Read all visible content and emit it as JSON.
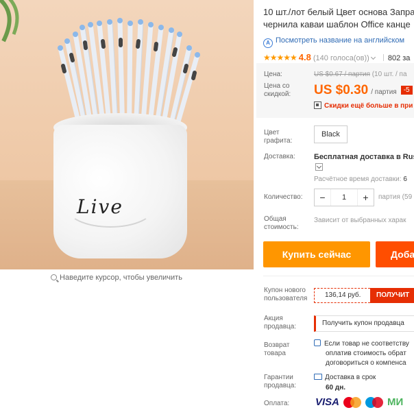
{
  "product": {
    "title_line1": "10 шт./лот белый Цвет основа Запра",
    "title_line2": "чернила каваи шаблон Office канце",
    "translate_label": "Посмотреть название на английском",
    "rating_value": "4.8",
    "votes": "(140 голоса(ов))",
    "orders": "802 за",
    "image_text": "Live",
    "zoom_hint": "Наведите курсор, чтобы увеличить"
  },
  "price": {
    "price_label": "Цена:",
    "old_price": "US $0.67 / партия",
    "old_price_note": "(10 шт. / па",
    "discount_label": "Цена со скидкой:",
    "new_price": "US $0.30",
    "unit": "/ партия",
    "discount_badge": "-5",
    "promo": "Скидки ещё больше в при"
  },
  "options": {
    "color_label": "Цвет графита:",
    "color_value": "Black",
    "delivery_label": "Доставка:",
    "delivery_value": "Бесплатная доставка в Russ",
    "delivery_time_label": "Расчётное время доставки:",
    "delivery_time_value": "6",
    "quantity_label": "Количество:",
    "quantity_value": "1",
    "quantity_minus": "−",
    "quantity_plus": "+",
    "quantity_note": "партия (59",
    "total_label": "Общая стоимость:",
    "total_note": "Зависит от выбранных харак"
  },
  "actions": {
    "buy_now": "Купить сейчас",
    "add_to_cart": "Доба"
  },
  "extras": {
    "coupon_label": "Купон нового пользователя",
    "coupon_value": "136,14 руб.",
    "coupon_button": "ПОЛУЧИТ",
    "seller_label": "Акция продавца:",
    "seller_button": "Получить купон продавца",
    "return_label": "Возврат товара",
    "return_line1": "Если товар не соответству",
    "return_line2": "оплатив стоимость обрат",
    "return_line3": "договориться о компенса",
    "guarantee_label": "Гарантии продавца:",
    "guarantee_text": "Доставка в срок",
    "guarantee_days": "60 дн.",
    "payment_label": "Оплата:",
    "payment_visa": "VISA",
    "payment_mir": "МИ"
  },
  "icons": [
    "translate-icon",
    "star-icon",
    "qr-icon",
    "dropdown-icon",
    "return-icon",
    "truck-icon",
    "magnifier-icon"
  ],
  "colors": {
    "accent": "#ff6600",
    "buy": "#ff9600",
    "cart": "#ff4e00",
    "promo": "#e62e04",
    "link": "#2f6bb5"
  }
}
